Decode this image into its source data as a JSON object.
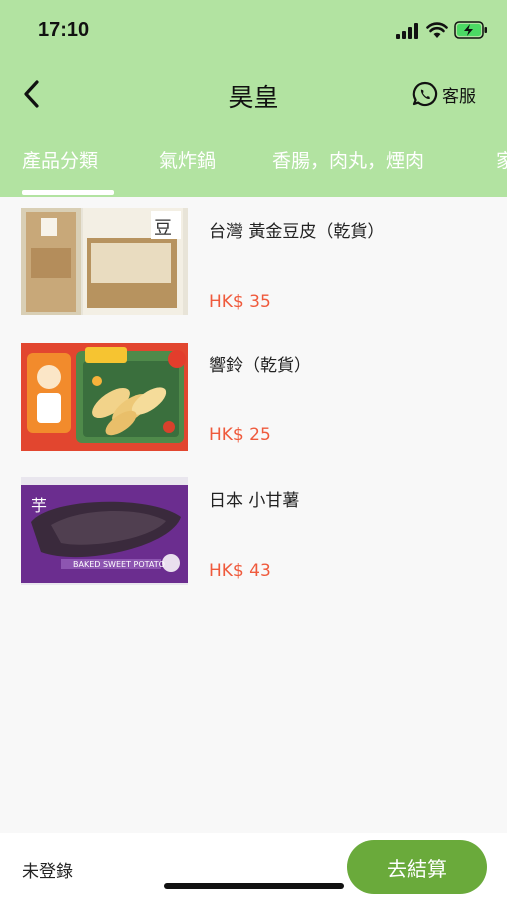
{
  "status_bar": {
    "time": "17:10"
  },
  "nav": {
    "title": "昊皇",
    "support_label": "客服"
  },
  "tabs": [
    {
      "label": "產品分類",
      "active": true
    },
    {
      "label": "氣炸鍋",
      "active": false
    },
    {
      "label": "香腸，肉丸，煙肉",
      "active": false
    },
    {
      "label": "家",
      "active": false
    }
  ],
  "products": [
    {
      "name": "台灣  黃金豆皮（乾貨）",
      "price": "HK$ 35"
    },
    {
      "name": "響鈴（乾貨）",
      "price": "HK$ 25"
    },
    {
      "name": "日本 小甘薯",
      "price": "HK$ 43"
    }
  ],
  "bottom_bar": {
    "login_status": "未登錄",
    "checkout_label": "去結算"
  },
  "colors": {
    "header_bg": "#b2e3a1",
    "checkout": "#6aaa3b",
    "price": "#ef5a3c"
  }
}
